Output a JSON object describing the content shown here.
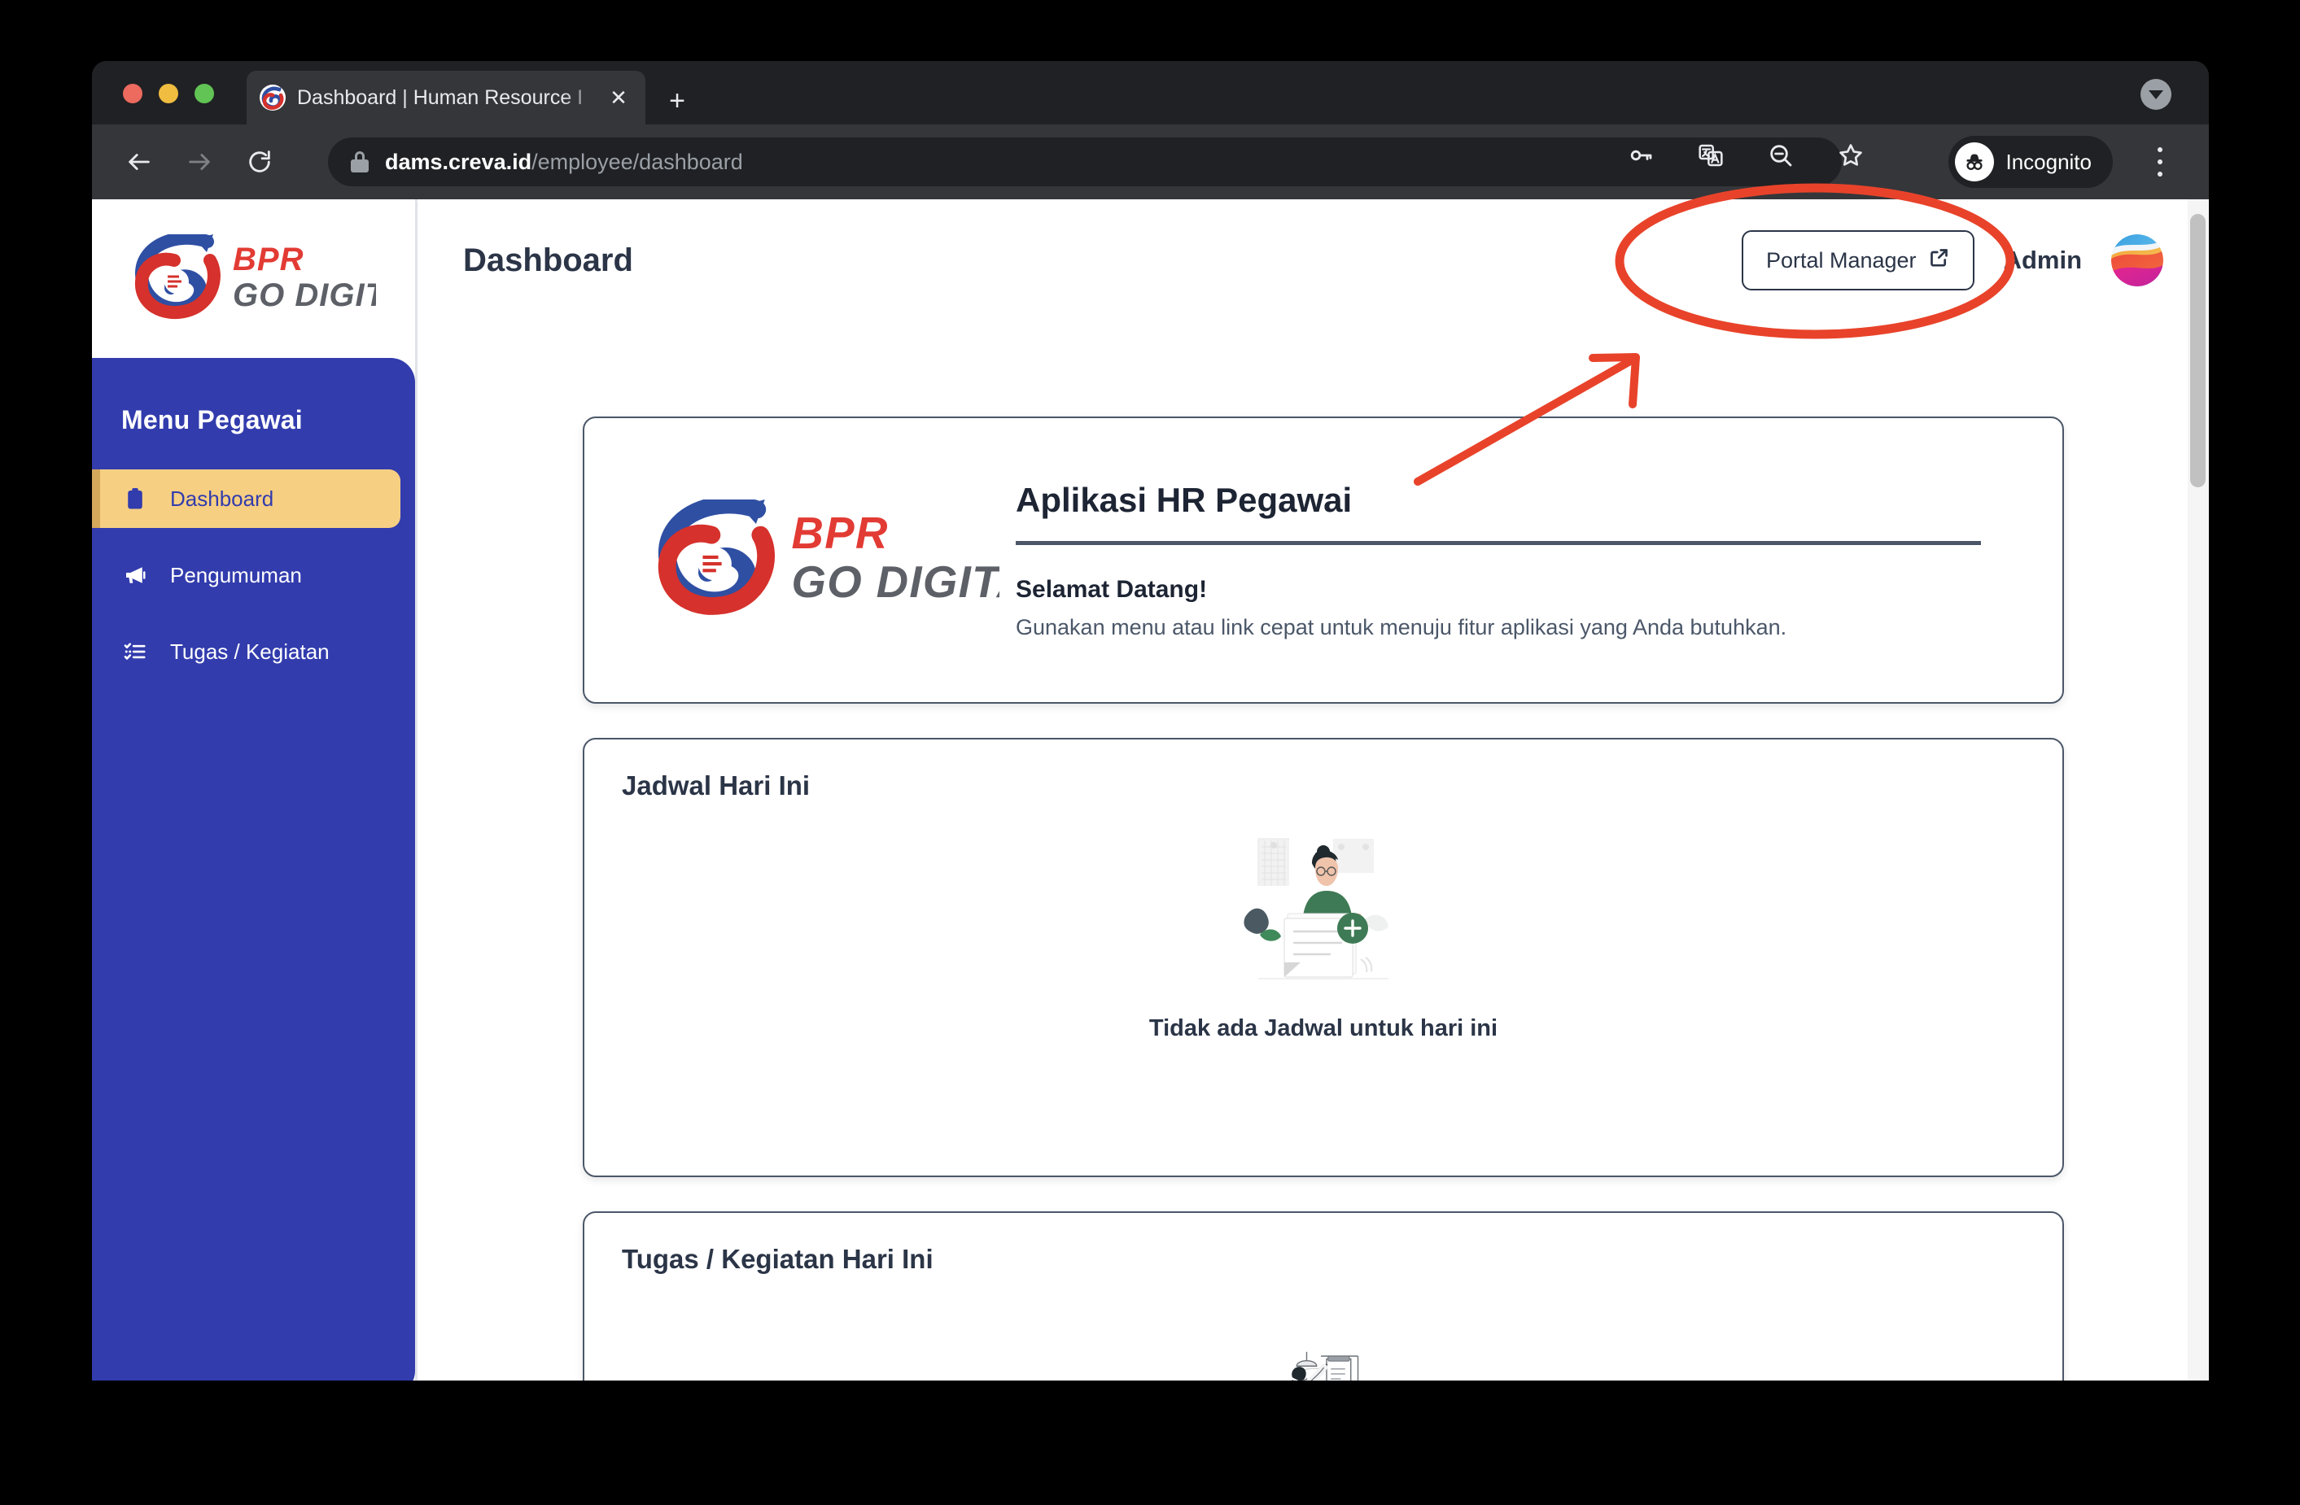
{
  "browser": {
    "tab": {
      "title": "Dashboard | Human Resource I",
      "favicon_name": "bpr-go-digital-favicon",
      "close_label": "✕"
    },
    "new_tab_label": "+",
    "tab_list_name": "tab-list-caret-icon",
    "toolbar": {
      "back_label": "←",
      "forward_label": "→",
      "reload_label": "⟳",
      "url_host": "dams.creva.id",
      "url_path": "/employee/dashboard",
      "lock_icon": "lock-icon",
      "icons": [
        "password-key-icon",
        "translate-icon",
        "zoom-out-icon",
        "bookmark-star-icon"
      ],
      "profile_label": "Incognito",
      "profile_icon": "incognito-hat-glasses-icon",
      "menu_label": "⋮"
    }
  },
  "sidebar": {
    "brand_name": "BPR GO DIGITAL",
    "brand_line1": "BPR",
    "brand_line2": "GO DIGITAL",
    "menu_title": "Menu Pegawai",
    "items": [
      {
        "label": "Dashboard",
        "icon": "clipboard-icon",
        "active": true
      },
      {
        "label": "Pengumuman",
        "icon": "megaphone-icon",
        "active": false
      },
      {
        "label": "Tugas / Kegiatan",
        "icon": "list-check-icon",
        "active": false
      }
    ]
  },
  "header": {
    "title": "Dashboard",
    "portal_button_label": "Portal Manager",
    "portal_button_icon": "external-link-icon",
    "admin_label": "Admin",
    "avatar_name": "admin-avatar"
  },
  "welcome_card": {
    "logo_name": "bpr-go-digital-logo",
    "heading": "Aplikasi HR Pegawai",
    "subheading": "Selamat Datang!",
    "body": "Gunakan menu atau link cepat untuk menuju fitur aplikasi yang Anda butuhkan."
  },
  "jadwal_card": {
    "title": "Jadwal Hari Ini",
    "empty_illustration": "woman-holding-document-illustration",
    "empty_caption": "Tidak ada Jadwal untuk hari ini"
  },
  "tugas_card": {
    "title": "Tugas / Kegiatan Hari Ini",
    "empty_illustration": "person-at-desk-illustration"
  },
  "scrollbar": {
    "name": "vertical-scrollbar"
  },
  "annotation": {
    "color": "#e8432a",
    "shapes": [
      "ellipse-highlight-around-portal-manager",
      "arrow-pointing-to-portal-manager"
    ]
  }
}
